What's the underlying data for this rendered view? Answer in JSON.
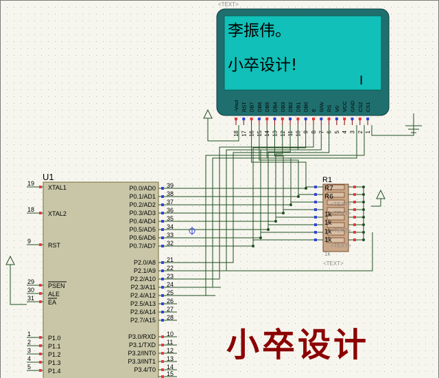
{
  "lcd": {
    "text_tag": "<TEXT>",
    "line1": "李振伟。",
    "line2": "小卒设计!",
    "cursor": "I",
    "pin_names": [
      "-Vout",
      "RST",
      "DB7",
      "DB6",
      "DB5",
      "DB4",
      "DB3",
      "DB2",
      "DB1",
      "DB0",
      "E",
      "R/W",
      "RS",
      "V0",
      "VCC",
      "GND",
      "CS2",
      "CS1"
    ],
    "pin_numbers": [
      "18",
      "17",
      "16",
      "15",
      "14",
      "13",
      "12",
      "11",
      "10",
      "9",
      "8",
      "7",
      "6",
      "5",
      "4",
      "3",
      "2",
      "1"
    ]
  },
  "mcu": {
    "name": "U1",
    "left_pins": [
      {
        "num": "19",
        "label": "XTAL1"
      },
      {
        "num": "18",
        "label": "XTAL2"
      },
      {
        "num": "9",
        "label": "RST"
      },
      {
        "num": "29",
        "label": "PSEN"
      },
      {
        "num": "30",
        "label": "ALE"
      },
      {
        "num": "31",
        "label": "EA"
      },
      {
        "num": "1",
        "label": "P1.0"
      },
      {
        "num": "2",
        "label": "P1.1"
      },
      {
        "num": "3",
        "label": "P1.2"
      },
      {
        "num": "4",
        "label": "P1.3"
      },
      {
        "num": "5",
        "label": "P1.4"
      }
    ],
    "right_pins": [
      {
        "num": "39",
        "label": "P0.0/AD0"
      },
      {
        "num": "38",
        "label": "P0.1/AD1"
      },
      {
        "num": "37",
        "label": "P0.2/AD2"
      },
      {
        "num": "36",
        "label": "P0.3/AD3"
      },
      {
        "num": "35",
        "label": "P0.4/AD4"
      },
      {
        "num": "34",
        "label": "P0.5/AD5"
      },
      {
        "num": "33",
        "label": "P0.6/AD6"
      },
      {
        "num": "32",
        "label": "P0.7/AD7"
      },
      {
        "num": "21",
        "label": "P2.0/A8"
      },
      {
        "num": "22",
        "label": "P2.1/A9"
      },
      {
        "num": "23",
        "label": "P2.2/A10"
      },
      {
        "num": "24",
        "label": "P2.3/A11"
      },
      {
        "num": "25",
        "label": "P2.4/A12"
      },
      {
        "num": "26",
        "label": "P2.5/A13"
      },
      {
        "num": "27",
        "label": "P2.6/A14"
      },
      {
        "num": "28",
        "label": "P2.7/A15"
      },
      {
        "num": "10",
        "label": "P3.0/RXD"
      },
      {
        "num": "11",
        "label": "P3.1/TXD"
      },
      {
        "num": "12",
        "label": "P3.2/INT0"
      },
      {
        "num": "13",
        "label": "P3.3/INT1"
      },
      {
        "num": "14",
        "label": "P3.4/T0"
      },
      {
        "num": "15",
        "label": ""
      }
    ]
  },
  "rpack": {
    "name": "R1",
    "labels": [
      "R7",
      "R6",
      "1k",
      "1k",
      "1k",
      "1k"
    ],
    "text_tags": [
      "<TEXT>",
      "<TEXT>",
      "<TEXT>",
      "<TEXT>"
    ],
    "bottom_label": "1k",
    "bottom_tag": "<TEXT>"
  },
  "watermark": "小卒设计",
  "colors": {
    "lcd_bezel": "#1f6f6f",
    "lcd_screen": "#11c0b8",
    "mcu_body": "#c8c6a7",
    "wire": "#1f4f1f",
    "pin_red": "#e63a3a",
    "pin_blue": "#2f44d8",
    "watermark": "#8b0000"
  }
}
